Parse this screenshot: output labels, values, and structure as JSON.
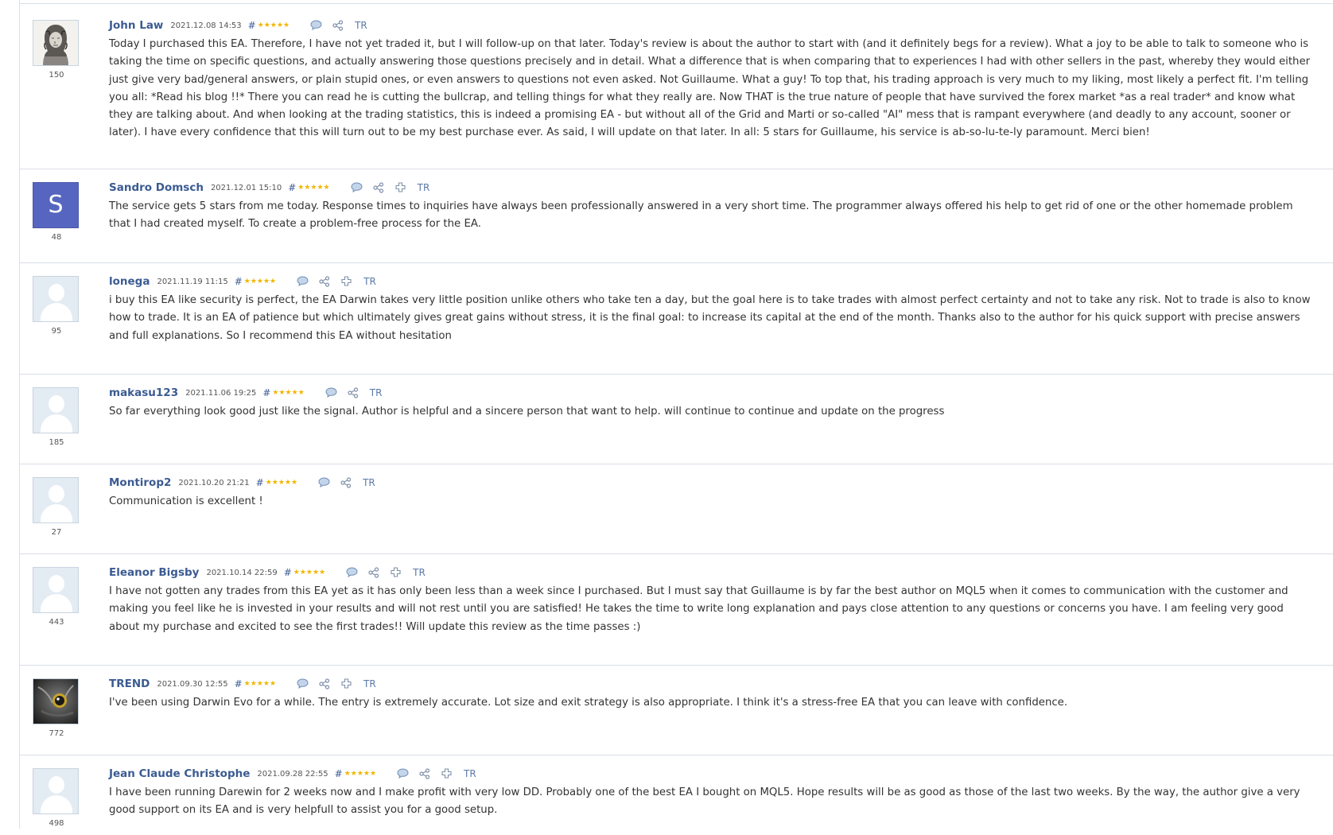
{
  "colors": {
    "link": "#3b5b92",
    "star": "#f1b600",
    "border": "#d9dee7",
    "letter_avatar": "#5665c0"
  },
  "reviews": [
    {
      "author": "John Law",
      "date": "2021.12.08 14:53",
      "hash": "#",
      "stars": "★★★★★",
      "rating_count": "150",
      "avatar": "portrait-engraving",
      "actions": [
        "comment-icon",
        "share-icon"
      ],
      "tr": "TR",
      "text": "Today I purchased this EA. Therefore, I have not yet traded it, but I will follow-up on that later. Today's review is about the author to start with (and it definitely begs for a review). What a joy to be able to talk to someone who is taking the time on specific questions, and actually answering those questions precisely and in detail. What a difference that is when comparing that to experiences I had with other sellers in the past, whereby they would either just give very bad/general answers, or plain stupid ones, or even answers to questions not even asked. Not Guillaume. What a guy! To top that, his trading approach is very much to my liking, most likely a perfect fit. I'm telling you all: *Read his blog !!* There you can read he is cutting the bullcrap, and telling things for what they really are. Now THAT is the true nature of people that have survived the forex market *as a real trader* and know what they are talking about. And when looking at the trading statistics, this is indeed a promising EA - but without all of the Grid and Marti or so-called \"AI\" mess that is rampant everywhere (and deadly to any account, sooner or later). I have every confidence that this will turn out to be my best purchase ever. As said, I will update on that later. In all: 5 stars for Guillaume, his service is ab-so-lu-te-ly paramount. Merci bien!"
    },
    {
      "author": "Sandro Domsch",
      "date": "2021.12.01 15:10",
      "hash": "#",
      "stars": "★★★★★",
      "rating_count": "48",
      "avatar": "S",
      "actions": [
        "comment-icon",
        "share-icon",
        "plus-icon"
      ],
      "tr": "TR",
      "text": "The service gets 5 stars from me today. Response times to inquiries have always been professionally answered in a very short time. The programmer always offered his help to get rid of one or the other homemade problem that I had created myself. To create a problem-free process for the EA."
    },
    {
      "author": "lonega",
      "date": "2021.11.19 11:15",
      "hash": "#",
      "stars": "★★★★★",
      "rating_count": "95",
      "avatar": "default",
      "actions": [
        "comment-icon",
        "share-icon",
        "plus-icon"
      ],
      "tr": "TR",
      "text": "i buy this EA like security is perfect, the EA Darwin takes very little position unlike others who take ten a day, but the goal here is to take trades with almost perfect certainty and not to take any risk. Not to trade is also to know how to trade. It is an EA of patience but which ultimately gives great gains without stress, it is the final goal: to increase its capital at the end of the month. Thanks also to the author for his quick support with precise answers and full explanations. So I recommend this EA without hesitation"
    },
    {
      "author": "makasu123",
      "date": "2021.11.06 19:25",
      "hash": "#",
      "stars": "★★★★★",
      "rating_count": "185",
      "avatar": "default",
      "actions": [
        "comment-icon",
        "share-icon"
      ],
      "tr": "TR",
      "text": "So far everything look good just like the signal. Author is helpful and a sincere person that want to help. will continue to continue and update on the progress"
    },
    {
      "author": "Montirop2",
      "date": "2021.10.20 21:21",
      "hash": "#",
      "stars": "★★★★★",
      "rating_count": "27",
      "avatar": "default",
      "actions": [
        "comment-icon",
        "share-icon"
      ],
      "tr": "TR",
      "text": "Communication is excellent !"
    },
    {
      "author": "Eleanor Bigsby",
      "date": "2021.10.14 22:59",
      "hash": "#",
      "stars": "★★★★★",
      "rating_count": "443",
      "avatar": "default",
      "actions": [
        "comment-icon",
        "share-icon",
        "plus-icon"
      ],
      "tr": "TR",
      "text": "I have not gotten any trades from this EA yet as it has only been less than a week since I purchased. But I must say that Guillaume is by far the best author on MQL5 when it comes to communication with the customer and making you feel like he is invested in your results and will not rest until you are satisfied! He takes the time to write long explanation and pays close attention to any questions or concerns you have. I am feeling very good about my purchase and excited to see the first trades!! Will update this review as the time passes :)"
    },
    {
      "author": "TREND",
      "date": "2021.09.30 12:55",
      "hash": "#",
      "stars": "★★★★★",
      "rating_count": "772",
      "avatar": "owl",
      "actions": [
        "comment-icon",
        "share-icon",
        "plus-icon"
      ],
      "tr": "TR",
      "text": "I've been using Darwin Evo for a while. The entry is extremely accurate. Lot size and exit strategy is also appropriate. I think it's a stress-free EA that you can leave with confidence."
    },
    {
      "author": "Jean Claude Christophe",
      "date": "2021.09.28 22:55",
      "hash": "#",
      "stars": "★★★★★",
      "rating_count": "498",
      "avatar": "default",
      "actions": [
        "comment-icon",
        "share-icon",
        "plus-icon"
      ],
      "tr": "TR",
      "text": "I have been running Darewin for 2 weeks now and I make profit with very low DD. Probably one of the best EA I bought on MQL5. Hope results will be as good as those of the last two weeks. By the way, the author give a very good support on its EA and is very helpfull to assist you for a good setup."
    }
  ]
}
